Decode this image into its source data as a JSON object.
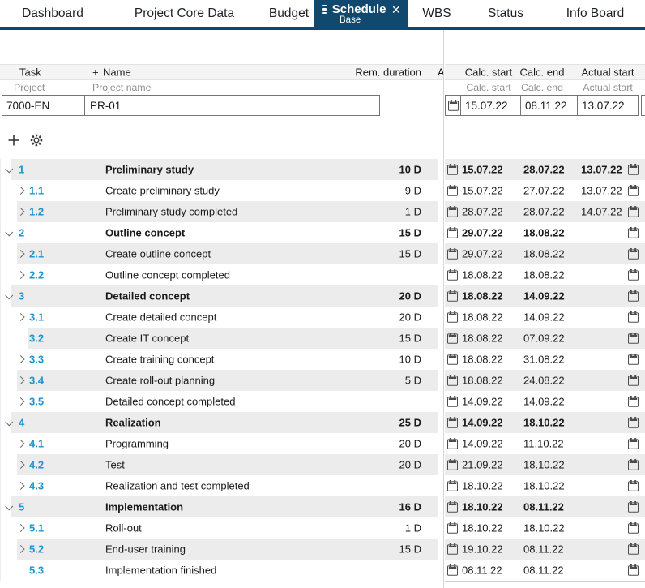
{
  "nav": {
    "tabs": [
      {
        "label": "Dashboard"
      },
      {
        "label": "Project Core Data"
      },
      {
        "label": "Budget"
      },
      {
        "label": "Schedule",
        "sublabel": "Base",
        "active": true
      },
      {
        "label": "WBS"
      },
      {
        "label": "Status"
      },
      {
        "label": "Info Board"
      }
    ]
  },
  "columns": {
    "task": "Task",
    "plus": "+",
    "name": "Name",
    "rem_duration": "Rem. duration",
    "truncated": "A",
    "calc_start": "Calc. start",
    "calc_end": "Calc. end",
    "actual_start": "Actual start"
  },
  "subcolumns": {
    "project": "Project",
    "project_name": "Project name",
    "calc_start": "Calc. start",
    "calc_end": "Calc. end",
    "actual_start": "Actual start"
  },
  "project": {
    "id": "7000-EN",
    "name": "PR-01",
    "calc_start": "15.07.22",
    "calc_end": "08.11.22",
    "actual_start": "13.07.22"
  },
  "toolbar": {
    "buttons": [
      {
        "icon": "add-icon"
      },
      {
        "icon": "settings-icon"
      }
    ]
  },
  "colors": {
    "accent_navy": "#11496e",
    "task_number_blue": "#1b96d5",
    "stripe_gray": "#ececec",
    "header_gray": "#f4f4f4"
  },
  "table": {
    "rows": [
      {
        "task": "1",
        "name": "Preliminary study",
        "duration": "10 D",
        "calc_start": "15.07.22",
        "calc_end": "28.07.22",
        "actual_start": "13.07.22",
        "level": 1,
        "chevron": "down"
      },
      {
        "task": "1.1",
        "name": "Create preliminary study",
        "duration": "9 D",
        "calc_start": "15.07.22",
        "calc_end": "27.07.22",
        "actual_start": "13.07.22",
        "level": 2,
        "chevron": "right"
      },
      {
        "task": "1.2",
        "name": "Preliminary study completed",
        "duration": "1 D",
        "calc_start": "28.07.22",
        "calc_end": "28.07.22",
        "actual_start": "14.07.22",
        "level": 2,
        "chevron": "right"
      },
      {
        "task": "2",
        "name": "Outline concept",
        "duration": "15 D",
        "calc_start": "29.07.22",
        "calc_end": "18.08.22",
        "actual_start": "",
        "level": 1,
        "chevron": "down"
      },
      {
        "task": "2.1",
        "name": "Create outline concept",
        "duration": "15 D",
        "calc_start": "29.07.22",
        "calc_end": "18.08.22",
        "actual_start": "",
        "level": 2,
        "chevron": "right"
      },
      {
        "task": "2.2",
        "name": "Outline concept completed",
        "duration": "",
        "calc_start": "18.08.22",
        "calc_end": "18.08.22",
        "actual_start": "",
        "level": 2,
        "chevron": "right"
      },
      {
        "task": "3",
        "name": "Detailed concept",
        "duration": "20 D",
        "calc_start": "18.08.22",
        "calc_end": "14.09.22",
        "actual_start": "",
        "level": 1,
        "chevron": "down"
      },
      {
        "task": "3.1",
        "name": "Create detailed concept",
        "duration": "20 D",
        "calc_start": "18.08.22",
        "calc_end": "14.09.22",
        "actual_start": "",
        "level": 2,
        "chevron": "right"
      },
      {
        "task": "3.2",
        "name": "Create IT concept",
        "duration": "15 D",
        "calc_start": "18.08.22",
        "calc_end": "07.09.22",
        "actual_start": "",
        "level": 2,
        "chevron": "none"
      },
      {
        "task": "3.3",
        "name": "Create training concept",
        "duration": "10 D",
        "calc_start": "18.08.22",
        "calc_end": "31.08.22",
        "actual_start": "",
        "level": 2,
        "chevron": "right"
      },
      {
        "task": "3.4",
        "name": "Create roll-out planning",
        "duration": "5 D",
        "calc_start": "18.08.22",
        "calc_end": "24.08.22",
        "actual_start": "",
        "level": 2,
        "chevron": "right"
      },
      {
        "task": "3.5",
        "name": "Detailed concept completed",
        "duration": "",
        "calc_start": "14.09.22",
        "calc_end": "14.09.22",
        "actual_start": "",
        "level": 2,
        "chevron": "right"
      },
      {
        "task": "4",
        "name": "Realization",
        "duration": "25 D",
        "calc_start": "14.09.22",
        "calc_end": "18.10.22",
        "actual_start": "",
        "level": 1,
        "chevron": "down"
      },
      {
        "task": "4.1",
        "name": "Programming",
        "duration": "20 D",
        "calc_start": "14.09.22",
        "calc_end": "11.10.22",
        "actual_start": "",
        "level": 2,
        "chevron": "right"
      },
      {
        "task": "4.2",
        "name": "Test",
        "duration": "20 D",
        "calc_start": "21.09.22",
        "calc_end": "18.10.22",
        "actual_start": "",
        "level": 2,
        "chevron": "right"
      },
      {
        "task": "4.3",
        "name": "Realization and test completed",
        "duration": "",
        "calc_start": "18.10.22",
        "calc_end": "18.10.22",
        "actual_start": "",
        "level": 2,
        "chevron": "right"
      },
      {
        "task": "5",
        "name": "Implementation",
        "duration": "16 D",
        "calc_start": "18.10.22",
        "calc_end": "08.11.22",
        "actual_start": "",
        "level": 1,
        "chevron": "down"
      },
      {
        "task": "5.1",
        "name": "Roll-out",
        "duration": "1 D",
        "calc_start": "18.10.22",
        "calc_end": "18.10.22",
        "actual_start": "",
        "level": 2,
        "chevron": "right"
      },
      {
        "task": "5.2",
        "name": "End-user training",
        "duration": "15 D",
        "calc_start": "19.10.22",
        "calc_end": "08.11.22",
        "actual_start": "",
        "level": 2,
        "chevron": "right"
      },
      {
        "task": "5.3",
        "name": "Implementation finished",
        "duration": "",
        "calc_start": "08.11.22",
        "calc_end": "08.11.22",
        "actual_start": "",
        "level": 2,
        "chevron": "none"
      }
    ]
  }
}
